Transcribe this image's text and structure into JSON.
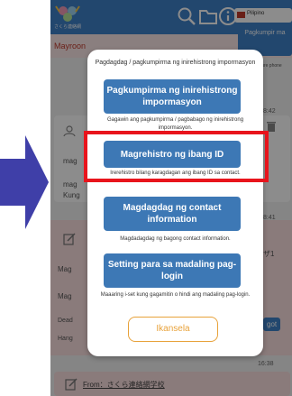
{
  "app": {
    "logo_caption": "さくら連絡網",
    "lang_label": "Pilipino",
    "room_tab": "Mayroon",
    "side_button": "Pagkumpir ma",
    "side_note": "ature phone"
  },
  "icons": {
    "search": "search-icon",
    "folder": "folder-icon",
    "info": "info-icon",
    "edit": "edit-icon",
    "trash": "trash-icon"
  },
  "background": {
    "times": [
      "8:42",
      "8:41",
      "16:38"
    ],
    "card_texts": [
      "mag",
      "mag",
      "Kung",
      "Mag",
      "Mag",
      "Dead",
      "Hang"
    ],
    "side_labels": [
      "ザ1",
      "got"
    ],
    "from_label": "From：さくら連絡網学校"
  },
  "modal": {
    "title": "Pagdagdag / pagkumpirma ng inirehistrong impormasyon",
    "buttons": [
      {
        "label": "Pagkumpirma ng inirehistrong impormasyon",
        "desc": "Gagawin ang pagkumpirma / pagbabago ng inirehistrong impormasyon."
      },
      {
        "label": "Magrehistro ng ibang ID",
        "desc": "Irerehistro bilang karagdagan ang ibang ID sa contact."
      },
      {
        "label": "Magdagdag ng contact information",
        "desc": "Magdadagdag ng bagong contact information."
      },
      {
        "label": "Setting para sa madaling pag-login",
        "desc": "Maaaring i-set kung gagamitin o hindi ang madaling pag-login."
      }
    ],
    "cancel_label": "Ikansela"
  },
  "colors": {
    "appbar": "#3f82c9",
    "modal_button": "#3d78b5",
    "cancel": "#e8a23a",
    "highlight": "#e8141c",
    "arrow": "#3f3fa8"
  }
}
